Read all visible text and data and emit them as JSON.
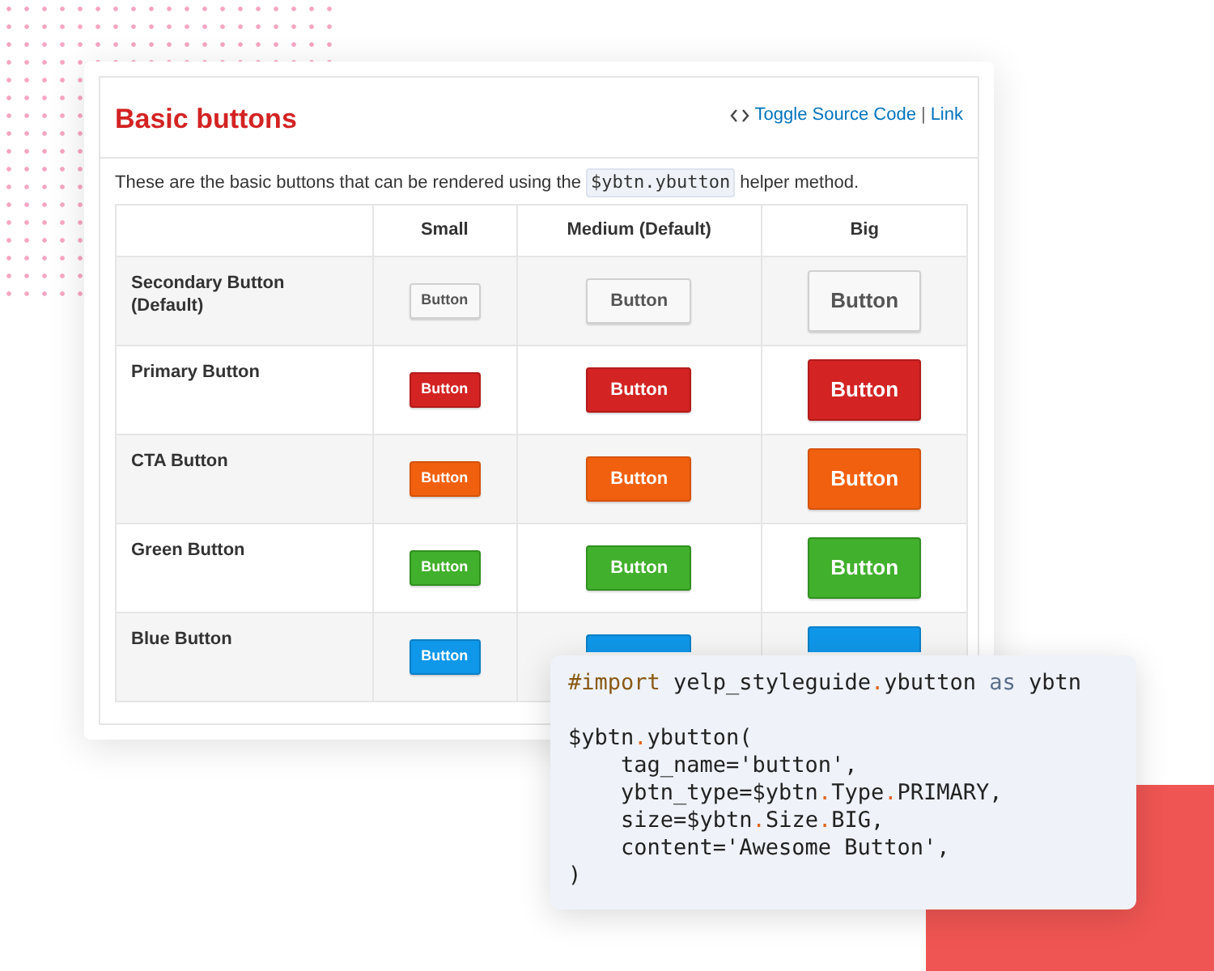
{
  "panel": {
    "title": "Basic buttons",
    "toggle_link": "Toggle Source Code",
    "separator": "|",
    "link": "Link",
    "description": {
      "before": "These are the basic buttons that can be rendered using the",
      "code": "$ybtn.ybutton",
      "after": "helper method."
    },
    "table": {
      "columns": [
        "Small",
        "Medium (Default)",
        "Big"
      ],
      "rows": [
        {
          "label": "Secondary Button (Default)",
          "kind": "secondary",
          "buttons": [
            {
              "label": "Button"
            },
            {
              "label": "Button"
            },
            {
              "label": "Button"
            }
          ]
        },
        {
          "label": "Primary Button",
          "kind": "primary",
          "buttons": [
            {
              "label": "Button"
            },
            {
              "label": "Button"
            },
            {
              "label": "Button"
            }
          ]
        },
        {
          "label": "CTA Button",
          "kind": "cta",
          "buttons": [
            {
              "label": "Button"
            },
            {
              "label": "Button"
            },
            {
              "label": "Button"
            }
          ]
        },
        {
          "label": "Green Button",
          "kind": "green",
          "buttons": [
            {
              "label": "Button"
            },
            {
              "label": "Button"
            },
            {
              "label": "Button"
            }
          ]
        },
        {
          "label": "Blue Button",
          "kind": "blue",
          "buttons": [
            {
              "label": "Button"
            },
            {
              "kind": "covered"
            },
            {
              "kind": "covered"
            }
          ]
        }
      ]
    }
  },
  "code_snippet": {
    "blocks": [
      [
        [
          {
            "text": "#import",
            "kind": "directive"
          },
          {
            "text": " yelp_styleguide",
            "kind": "plain"
          },
          {
            "text": ".",
            "kind": "op"
          },
          {
            "text": "ybutton ",
            "kind": "plain"
          },
          {
            "text": "as",
            "kind": "keyword"
          },
          {
            "text": " ybtn",
            "kind": "plain"
          }
        ]
      ],
      [
        [
          {
            "text": "$ybtn",
            "kind": "plain"
          },
          {
            "text": ".",
            "kind": "op"
          },
          {
            "text": "ybutton(",
            "kind": "plain"
          }
        ],
        [
          {
            "text": "    tag_name='button',",
            "kind": "plain"
          }
        ],
        [
          {
            "text": "    ybtn_type=$ybtn",
            "kind": "plain"
          },
          {
            "text": ".",
            "kind": "op"
          },
          {
            "text": "Type",
            "kind": "plain"
          },
          {
            "text": ".",
            "kind": "op"
          },
          {
            "text": "PRIMARY,",
            "kind": "plain"
          }
        ],
        [
          {
            "text": "    size=$ybtn",
            "kind": "plain"
          },
          {
            "text": ".",
            "kind": "op"
          },
          {
            "text": "Size",
            "kind": "plain"
          },
          {
            "text": ".",
            "kind": "op"
          },
          {
            "text": "BIG,",
            "kind": "plain"
          }
        ],
        [
          {
            "text": "    content='Awesome Button',",
            "kind": "plain"
          }
        ],
        [
          {
            "text": ")",
            "kind": "plain"
          }
        ]
      ]
    ]
  }
}
